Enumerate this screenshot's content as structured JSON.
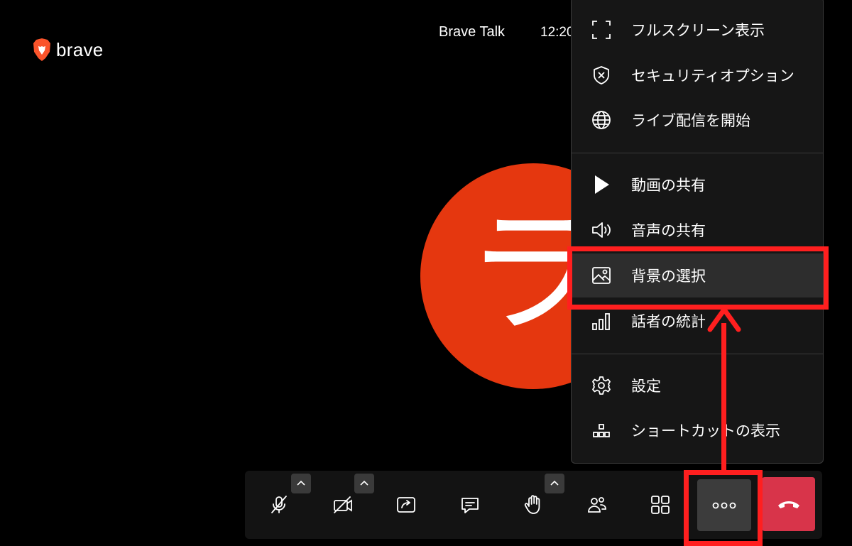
{
  "app": {
    "logo_text": "brave",
    "title": "Brave Talk",
    "time": "12:20"
  },
  "avatar": {
    "initial": "ラ",
    "color": "#e5370f"
  },
  "menu": {
    "groups": [
      [
        {
          "label": "フルスクリーン表示",
          "icon": "fullscreen-icon"
        },
        {
          "label": "セキュリティオプション",
          "icon": "shield-x-icon"
        },
        {
          "label": "ライブ配信を開始",
          "icon": "globe-icon"
        }
      ],
      [
        {
          "label": "動画の共有",
          "icon": "play-icon"
        },
        {
          "label": "音声の共有",
          "icon": "speaker-icon"
        },
        {
          "label": "背景の選択",
          "icon": "image-icon",
          "highlighted": true
        },
        {
          "label": "話者の統計",
          "icon": "bar-chart-icon"
        }
      ],
      [
        {
          "label": "設定",
          "icon": "gear-icon"
        },
        {
          "label": "ショートカットの表示",
          "icon": "shortcuts-icon"
        }
      ]
    ]
  },
  "toolbar": {
    "buttons": [
      {
        "name": "microphone-muted",
        "icon": "mic-off-icon",
        "has_caret": true
      },
      {
        "name": "camera-off",
        "icon": "camera-off-icon",
        "has_caret": true
      },
      {
        "name": "share-screen",
        "icon": "share-screen-icon",
        "has_caret": false
      },
      {
        "name": "chat",
        "icon": "chat-icon",
        "has_caret": false
      },
      {
        "name": "raise-hand",
        "icon": "hand-icon",
        "has_caret": true
      },
      {
        "name": "participants",
        "icon": "participants-icon",
        "has_caret": false
      },
      {
        "name": "tile-view",
        "icon": "grid-icon",
        "has_caret": false
      },
      {
        "name": "more-actions",
        "icon": "ellipsis-icon",
        "has_caret": false
      },
      {
        "name": "hang-up",
        "icon": "hangup-icon",
        "has_caret": false
      }
    ]
  },
  "colors": {
    "background": "#000000",
    "menu_background": "#161616",
    "accent_orange": "#e5370f",
    "hangup_red": "#d8344a",
    "annotation_red": "#ff1f1f"
  }
}
